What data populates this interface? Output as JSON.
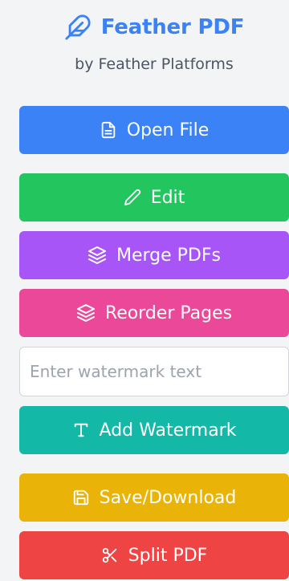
{
  "header": {
    "title": "Feather PDF",
    "subtitle": "by Feather Platforms",
    "icon": "feather-icon",
    "accent_color": "#3b82f6"
  },
  "buttons": {
    "open_file": {
      "label": "Open File",
      "icon": "file-icon",
      "color": "#3b82f6"
    },
    "edit": {
      "label": "Edit",
      "icon": "pencil-icon",
      "color": "#22c55e"
    },
    "merge": {
      "label": "Merge PDFs",
      "icon": "layers-icon",
      "color": "#a855f7"
    },
    "reorder": {
      "label": "Reorder Pages",
      "icon": "layers-icon",
      "color": "#ec4899"
    },
    "add_watermark": {
      "label": "Add Watermark",
      "icon": "type-icon",
      "color": "#14b8a6"
    },
    "save": {
      "label": "Save/Download",
      "icon": "save-icon",
      "color": "#eab308"
    },
    "split": {
      "label": "Split PDF",
      "icon": "scissors-icon",
      "color": "#ef4444"
    }
  },
  "watermark_input": {
    "placeholder": "Enter watermark text",
    "value": ""
  }
}
